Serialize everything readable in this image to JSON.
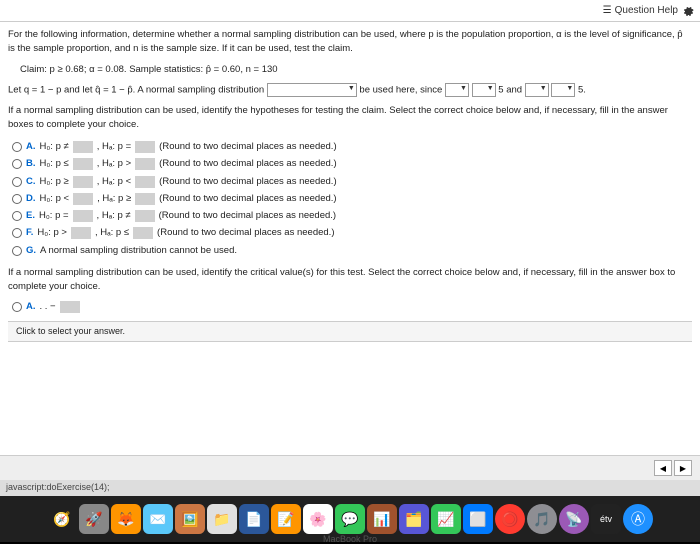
{
  "header": {
    "question_help": "Question Help"
  },
  "intro": "For the following information, determine whether a normal sampling distribution can be used, where p is the population proportion, α is the level of significance, p̂ is the sample proportion, and n is the sample size. If it can be used, test the claim.",
  "claim": "Claim: p ≥ 0.68; α = 0.08. Sample statistics: p̂ = 0.60, n = 130",
  "line2_a": "Let q = 1 − p and let q̂ = 1 − p̂. A normal sampling distribution",
  "line2_b": "be used here, since",
  "line2_c": "5 and",
  "line2_d": "5.",
  "instr": "If a normal sampling distribution can be used, identify the hypotheses for testing the claim. Select the correct choice below and, if necessary, fill in the answer boxes to complete your choice.",
  "opts": {
    "a": {
      "l": "A.",
      "h0": "H₀: p ≠",
      "ha": ", Hₐ: p =",
      "tail": "(Round to two decimal places as needed.)"
    },
    "b": {
      "l": "B.",
      "h0": "H₀: p ≤",
      "ha": ", Hₐ: p >",
      "tail": "(Round to two decimal places as needed.)"
    },
    "c": {
      "l": "C.",
      "h0": "H₀: p ≥",
      "ha": ", Hₐ: p <",
      "tail": "(Round to two decimal places as needed.)"
    },
    "d": {
      "l": "D.",
      "h0": "H₀: p <",
      "ha": ", Hₐ: p ≥",
      "tail": "(Round to two decimal places as needed.)"
    },
    "e": {
      "l": "E.",
      "h0": "H₀: p =",
      "ha": ", Hₐ: p ≠",
      "tail": "(Round to two decimal places as needed.)"
    },
    "f": {
      "l": "F.",
      "h0": "H₀: p >",
      "ha": ", Hₐ: p ≤",
      "tail": "(Round to two decimal places as needed.)"
    },
    "g": {
      "l": "G.",
      "txt": "A normal sampling distribution cannot be used."
    }
  },
  "instr2": "If a normal sampling distribution can be used, identify the critical value(s) for this test. Select the correct choice below and, if necessary, fill in the answer box to complete your choice.",
  "lastopt": "A.",
  "clickmsg": "Click to select your answer.",
  "status": "javascript:doExercise(14);",
  "dock": {
    "safari": "#1e90ff",
    "launchpad": "#888",
    "firefox": "#ff9500",
    "mail": "#5ac8fa",
    "preview": "#cc7744",
    "files": "#e0e0e0",
    "word": "#2b579a",
    "pages": "#ff9500",
    "photos": "#ff2d55",
    "messages": "#34c759",
    "app1": "#a0522d",
    "app2": "#5856d6",
    "numbers": "#34c759",
    "app3": "#007aff",
    "redcircle": "#ff3b30",
    "music": "#8e8e93",
    "podcast": "#9b59b6",
    "tv_label": "étv",
    "appstore": "#1e90ff"
  },
  "macbook": "MacBook Pro"
}
